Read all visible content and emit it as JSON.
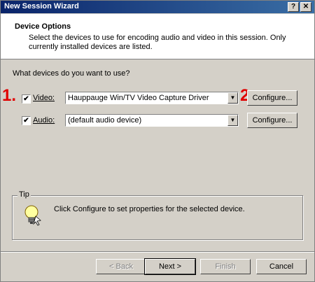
{
  "window": {
    "title": "New Session Wizard"
  },
  "header": {
    "title": "Device Options",
    "description": "Select the devices to use for encoding audio and video in this session. Only currently installed devices are listed."
  },
  "question": "What devices do you want to use?",
  "annotations": {
    "one": "1.",
    "two": "2."
  },
  "video": {
    "label": "Video:",
    "checked": true,
    "device": "Hauppauge Win/TV Video Capture Driver",
    "configure": "Configure..."
  },
  "audio": {
    "label": "Audio:",
    "checked": true,
    "device": "(default audio device)",
    "configure": "Configure..."
  },
  "tip": {
    "label": "Tip",
    "text": "Click Configure to set properties for the selected device."
  },
  "footer": {
    "back": "< Back",
    "next": "Next >",
    "finish": "Finish",
    "cancel": "Cancel"
  },
  "colors": {
    "titlebar": "#0a246a",
    "annotation": "#e00000",
    "face": "#d4d0c8"
  }
}
